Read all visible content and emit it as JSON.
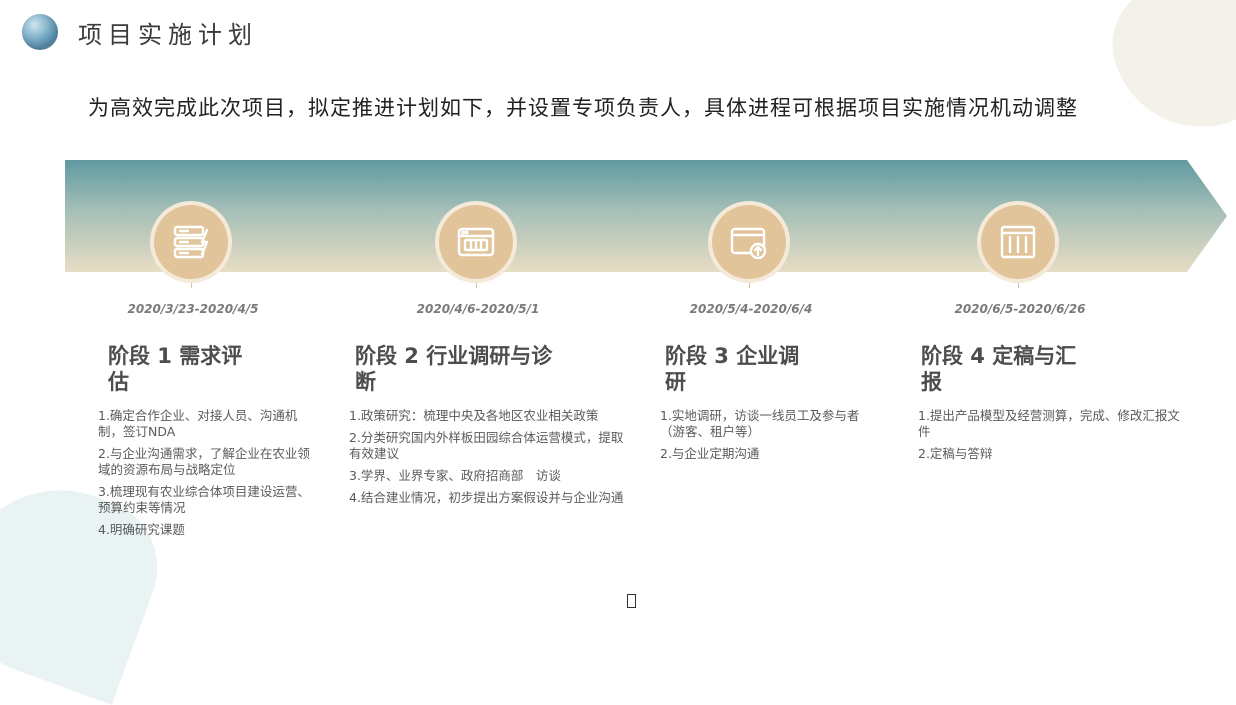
{
  "header": {
    "title": "项目实施计划"
  },
  "subtitle": "为高效完成此次项目，拟定推进计划如下，并设置专项负责人，具体进程可根据项目实施情况机动调整",
  "colors": {
    "band_start": "#5f9aa0",
    "band_end": "#e7ddc4",
    "circle": "#e1c49a",
    "title_text": "#4d4d4d"
  },
  "phases": [
    {
      "icon": "server-stack-icon",
      "date": "2020/3/23-2020/4/5",
      "title": "阶段 1 需求评\n估",
      "items": [
        "1.确定合作企业、对接人员、沟通机制，签订NDA",
        "2.与企业沟通需求，了解企业在农业领域的资源布局与战略定位",
        "3.梳理现有农业综合体项目建设运营、预算约束等情况",
        "4.明确研究课题"
      ]
    },
    {
      "icon": "browser-window-icon",
      "date": "2020/4/6-2020/5/1",
      "title": "阶段 2 行业调研与诊\n断",
      "items": [
        "1.政策研究：梳理中央及各地区农业相关政策",
        "2.分类研究国内外样板田园综合体运营模式，提取有效建议",
        "3.学界、业界专家、政府招商部　访谈",
        "4.结合建业情况，初步提出方案假设并与企业沟通"
      ]
    },
    {
      "icon": "upload-window-icon",
      "date": "2020/5/4-2020/6/4",
      "title": "阶段 3 企业调\n研",
      "items": [
        "1.实地调研，访谈一线员工及参与者（游客、租户等）",
        "2.与企业定期沟通"
      ]
    },
    {
      "icon": "columns-building-icon",
      "date": "2020/6/5-2020/6/26",
      "title": "阶段 4 定稿与汇\n报",
      "items": [
        "1.提出产品模型及经营测算，完成、修改汇报文件",
        "2.定稿与答辩"
      ]
    }
  ]
}
